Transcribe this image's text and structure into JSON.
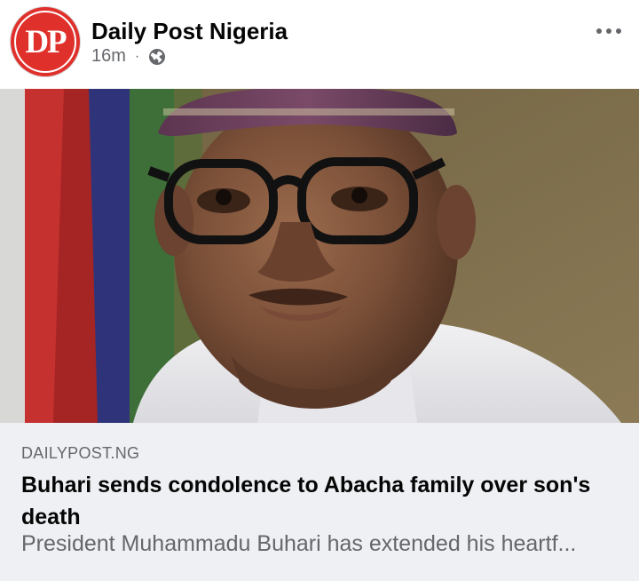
{
  "post": {
    "page_name": "Daily Post Nigeria",
    "avatar_text": "DP",
    "time": "16m",
    "separator": "·",
    "audience_icon": "globe-icon",
    "more_icon": "more-options-icon"
  },
  "link_preview": {
    "domain": "DAILYPOST.NG",
    "headline": "Buhari sends condolence to Abacha family over son's death",
    "excerpt": "President Muhammadu Buhari has extended his heartf..."
  },
  "colors": {
    "brand_red": "#e0302b",
    "link_background": "#eef0f3",
    "secondary_text": "#65676b"
  }
}
